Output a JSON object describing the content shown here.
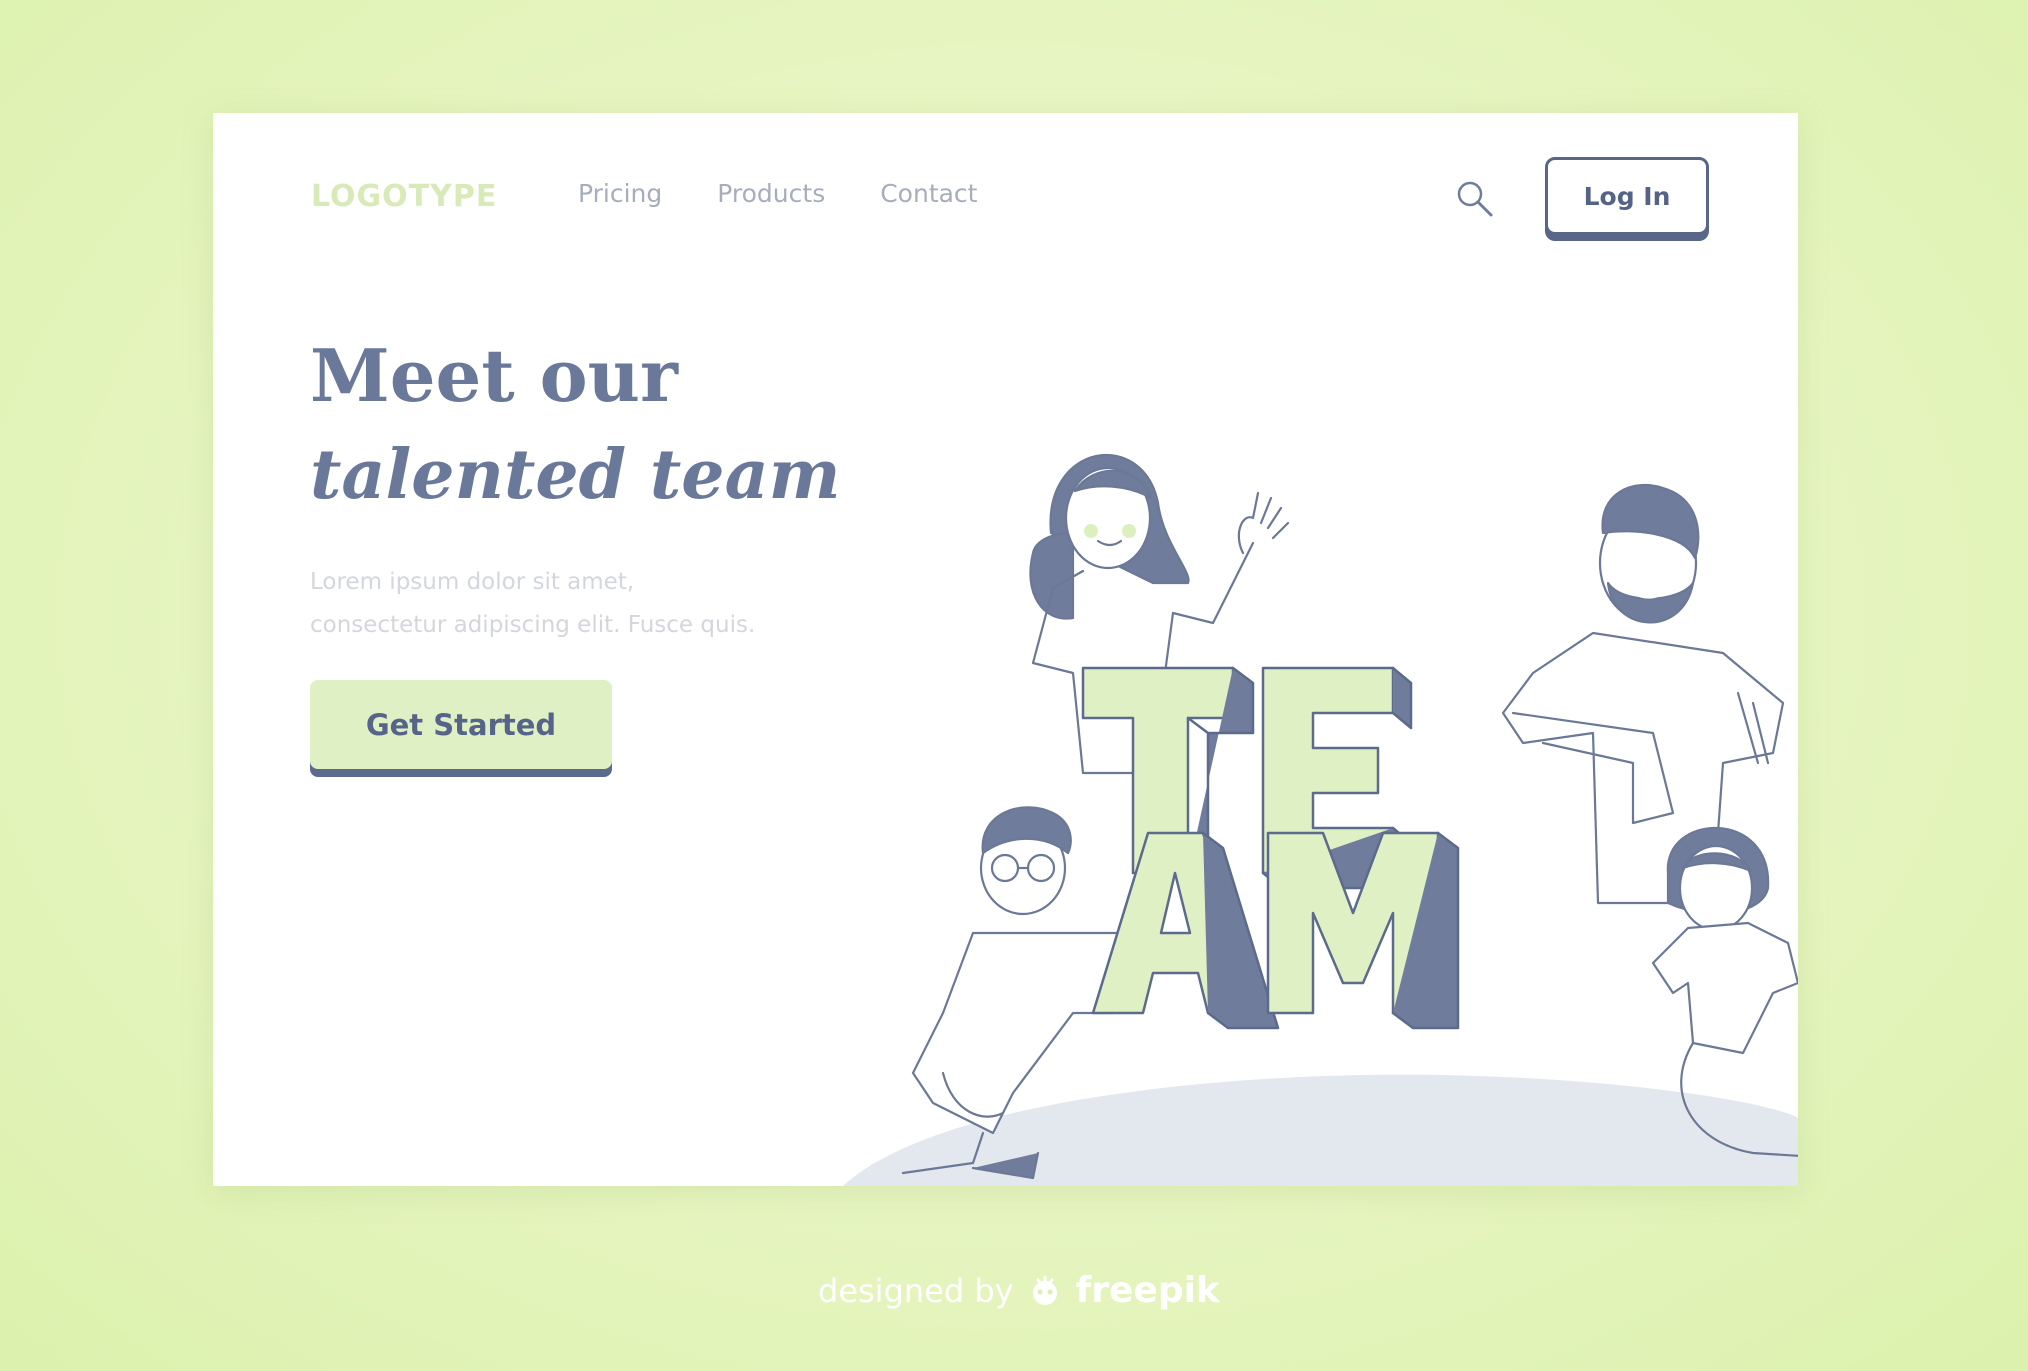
{
  "header": {
    "logo": "LOGOTYPE",
    "nav": [
      {
        "label": "Pricing"
      },
      {
        "label": "Products"
      },
      {
        "label": "Contact"
      }
    ],
    "search_icon": "search-icon",
    "login_label": "Log In"
  },
  "hero": {
    "title": "Meet our",
    "subtitle": "talented team",
    "body_line1": "Lorem ipsum dolor sit amet,",
    "body_line2": "consectetur  adipiscing elit. Fusce quis.",
    "cta_label": "Get Started"
  },
  "illustration": {
    "letters_top": "TE",
    "letters_bottom": "AM"
  },
  "footer": {
    "prefix": "designed by",
    "brand": "freepik"
  },
  "colors": {
    "accent_green": "#dff0c4",
    "navy": "#5c6a8c",
    "text_muted": "#a6aebb",
    "background": "#e6f5c0"
  }
}
